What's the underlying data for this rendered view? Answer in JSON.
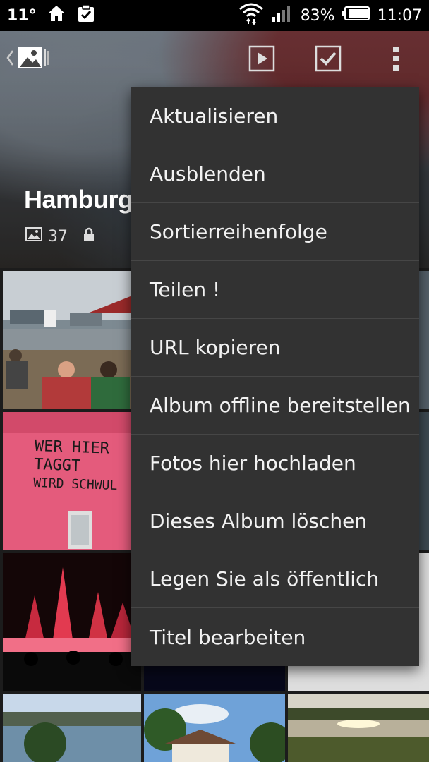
{
  "statusbar": {
    "temperature": "11°",
    "battery": "83%",
    "time": "11:07"
  },
  "album": {
    "title": "Hamburg-S",
    "photo_count": "37"
  },
  "menu": {
    "items": [
      {
        "label": "Aktualisieren"
      },
      {
        "label": "Ausblenden"
      },
      {
        "label": "Sortierreihenfolge"
      },
      {
        "label": "Teilen !"
      },
      {
        "label": "URL kopieren"
      },
      {
        "label": "Album offline bereitstellen"
      },
      {
        "label": "Fotos hier hochladen"
      },
      {
        "label": "Dieses Album löschen"
      },
      {
        "label": "Legen Sie als öffentlich"
      },
      {
        "label": "Titel bearbeiten"
      }
    ]
  },
  "photo_text": {
    "graffiti_line1": "WER HIER",
    "graffiti_line2": "TAGGT",
    "graffiti_line3": "WIRD SCHWUL"
  },
  "icons": {
    "home": "home-icon",
    "clipboard": "clipboard-check-icon",
    "wifi": "wifi-icon",
    "signal": "signal-icon",
    "battery": "battery-icon",
    "gallery": "gallery-icon",
    "slideshow": "slideshow-icon",
    "select": "checkbox-icon",
    "overflow": "overflow-menu-icon",
    "photo": "photo-icon",
    "lock": "lock-icon"
  }
}
